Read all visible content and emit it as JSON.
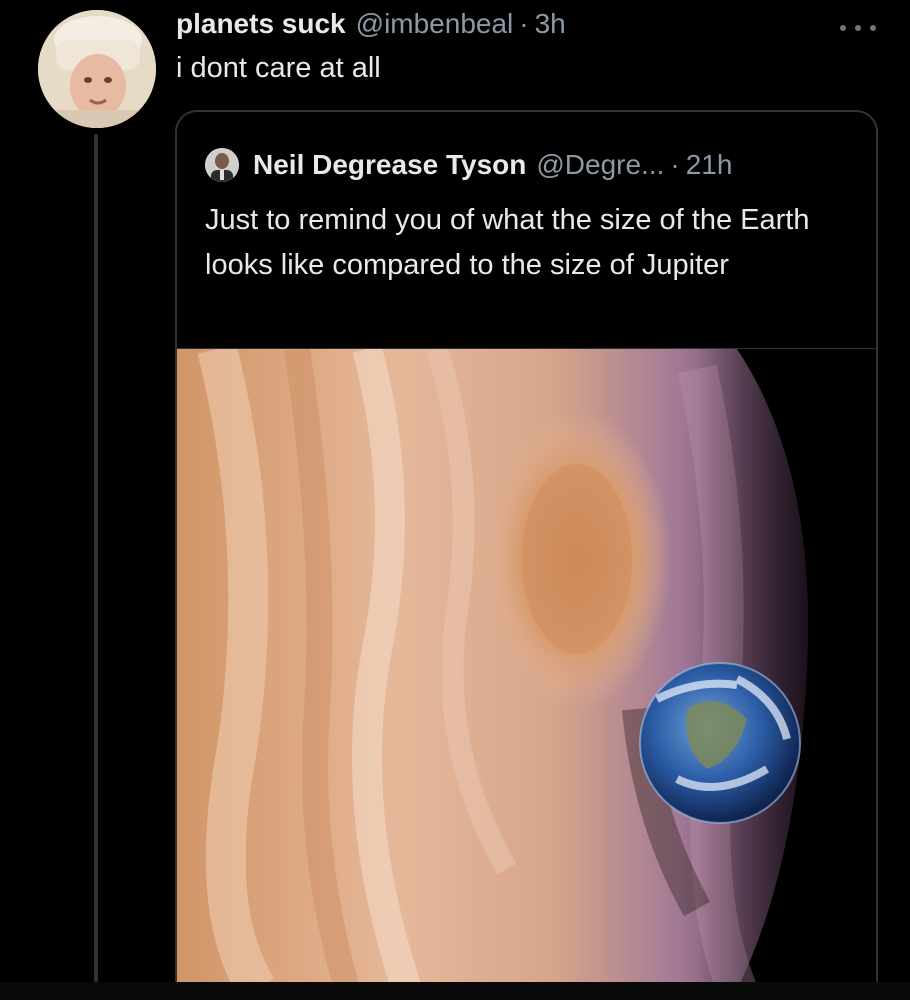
{
  "tweet": {
    "author_name": "planets suck",
    "author_handle": "@imbenbeal",
    "separator": "·",
    "time": "3h",
    "text": "i dont care at all",
    "avatar_icon": "user-avatar-icon",
    "more_icon": "more-options-icon"
  },
  "quote": {
    "author_name": "Neil Degrease Tyson",
    "author_handle": "@Degre...",
    "separator": "·",
    "time": "21h",
    "text": "Just to remind you of what the size of the Earth looks like compared to the size of Jupiter",
    "avatar_icon": "user-avatar-icon",
    "media_icon": "jupiter-earth-image"
  },
  "colors": {
    "background": "#000000",
    "text_primary": "#e7e9ea",
    "text_secondary": "#8b98a5",
    "border": "#2f3336"
  }
}
